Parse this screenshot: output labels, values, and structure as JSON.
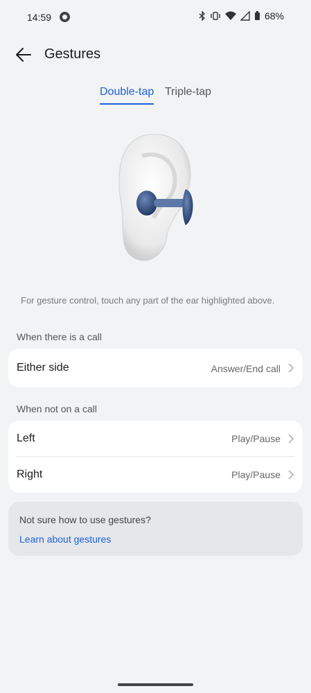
{
  "status_bar": {
    "time": "14:59",
    "battery": "68%"
  },
  "header": {
    "title": "Gestures"
  },
  "tabs": [
    {
      "label": "Double-tap",
      "active": true
    },
    {
      "label": "Triple-tap",
      "active": false
    }
  ],
  "hint": "For gesture control, touch any part of the ear highlighted above.",
  "call_section": {
    "label": "When there is a call",
    "rows": [
      {
        "label": "Either side",
        "value": "Answer/End call"
      }
    ]
  },
  "no_call_section": {
    "label": "When not on a call",
    "rows": [
      {
        "label": "Left",
        "value": "Play/Pause"
      },
      {
        "label": "Right",
        "value": "Play/Pause"
      }
    ]
  },
  "help": {
    "question": "Not sure how to use gestures?",
    "link": "Learn about gestures"
  },
  "colors": {
    "accent": "#1f60d6",
    "background": "#f1f3f5",
    "card": "#ffffff"
  }
}
